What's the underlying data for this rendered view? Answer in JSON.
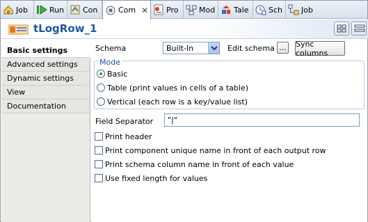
{
  "tabs": [
    {
      "label": "Job",
      "icon": "job-icon"
    },
    {
      "label": "Run",
      "icon": "run-icon"
    },
    {
      "label": "Con",
      "icon": "contexts-icon"
    },
    {
      "label": "Com",
      "icon": "component-icon",
      "active": true,
      "close": "✕"
    },
    {
      "label": "Pro",
      "icon": "problems-icon"
    },
    {
      "label": "Mod",
      "icon": "modules-icon"
    },
    {
      "label": "Tale",
      "icon": "talend-icon"
    },
    {
      "label": "Sch",
      "icon": "scheduler-icon"
    },
    {
      "label": "Job",
      "icon": "job-hierarchy-icon"
    }
  ],
  "title": "tLogRow_1",
  "sidebar": {
    "items": [
      {
        "label": "Basic settings",
        "active": true
      },
      {
        "label": "Advanced settings"
      },
      {
        "label": "Dynamic settings"
      },
      {
        "label": "View"
      },
      {
        "label": "Documentation"
      }
    ]
  },
  "form": {
    "schema_label": "Schema",
    "schema_value": "Built-In",
    "edit_schema_label": "Edit schema",
    "edit_schema_button": "...",
    "sync_columns_button": "Sync columns",
    "mode_legend": "Mode",
    "mode_options": [
      {
        "label": "Basic",
        "selected": true
      },
      {
        "label": "Table (print values in cells of a table)",
        "selected": false
      },
      {
        "label": "Vertical (each row is a key/value list)",
        "selected": false
      }
    ],
    "field_separator_label": "Field Separator",
    "field_separator_value": "\"|\"",
    "checkboxes": [
      {
        "label": "Print header",
        "checked": false
      },
      {
        "label": "Print component unique name in front of each output row",
        "checked": false
      },
      {
        "label": "Print schema column name in front of each value",
        "checked": false
      },
      {
        "label": "Use fixed length for values",
        "checked": false
      }
    ]
  },
  "colors": {
    "title": "#1c57a6",
    "legend": "#2050a0",
    "radio_selected": "#2ea81a"
  }
}
